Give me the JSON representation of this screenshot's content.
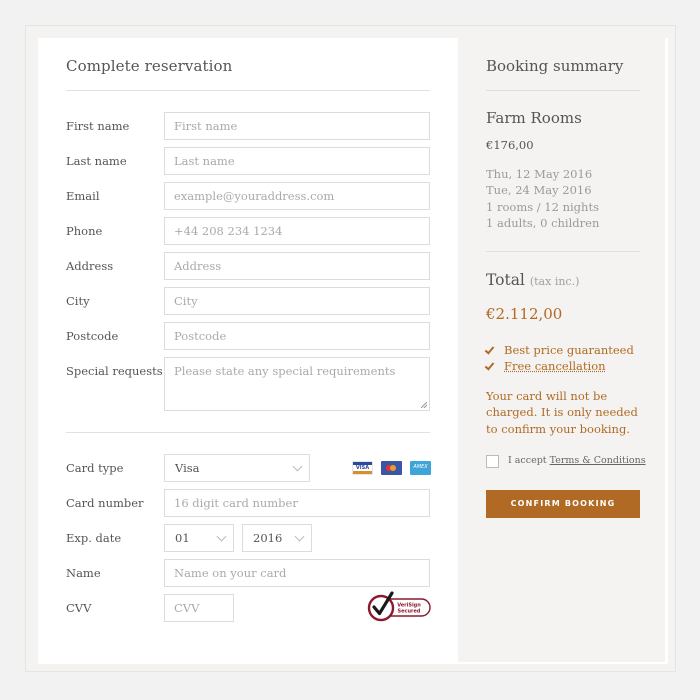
{
  "form": {
    "title": "Complete reservation",
    "personal_fields": [
      {
        "label": "First name",
        "placeholder": "First name"
      },
      {
        "label": "Last name",
        "placeholder": "Last name"
      },
      {
        "label": "Email",
        "placeholder": "example@youraddress.com"
      },
      {
        "label": "Phone",
        "placeholder": "+44 208 234 1234"
      },
      {
        "label": "Address",
        "placeholder": "Address"
      },
      {
        "label": "City",
        "placeholder": "City"
      },
      {
        "label": "Postcode",
        "placeholder": "Postcode"
      }
    ],
    "special_requests": {
      "label": "Special requests",
      "placeholder": "Please state any special requirements"
    },
    "payment": {
      "card_type": {
        "label": "Card type",
        "value": "Visa"
      },
      "card_icons": [
        {
          "name": "visa-card-icon",
          "text": "VISA"
        },
        {
          "name": "mastercard-icon",
          "text": ""
        },
        {
          "name": "amex-card-icon",
          "text": "AMEX"
        }
      ],
      "card_number": {
        "label": "Card number",
        "placeholder": "16 digit card number"
      },
      "exp_date": {
        "label": "Exp. date",
        "month": "01",
        "year": "2016"
      },
      "name": {
        "label": "Name",
        "placeholder": "Name on your card"
      },
      "cvv": {
        "label": "CVV",
        "placeholder": "CVV"
      },
      "badge": {
        "line1": "VeriSign",
        "line2": "Secured"
      }
    }
  },
  "summary": {
    "title": "Booking summary",
    "room_name": "Farm Rooms",
    "room_price": "€176,00",
    "details": [
      "Thu, 12 May 2016",
      "Tue, 24 May 2016",
      "1 rooms / 12 nights",
      "1 adults, 0 children"
    ],
    "total_label": "Total",
    "total_note": "(tax inc.)",
    "total_value": "€2.112,00",
    "benefits": [
      {
        "text": "Best price guaranteed",
        "link": false
      },
      {
        "text": "Free cancellation",
        "link": true
      }
    ],
    "card_note": "Your card will not be charged. It is only needed to confirm your booking.",
    "accept_prefix": "I accept",
    "accept_link": "Terms & Conditions",
    "accept_checked": false,
    "confirm_label": "CONFIRM BOOKING"
  },
  "colors": {
    "accent": "#b06a24",
    "panel_bg": "#f4f3f1",
    "page_bg": "#f2f2f2"
  }
}
